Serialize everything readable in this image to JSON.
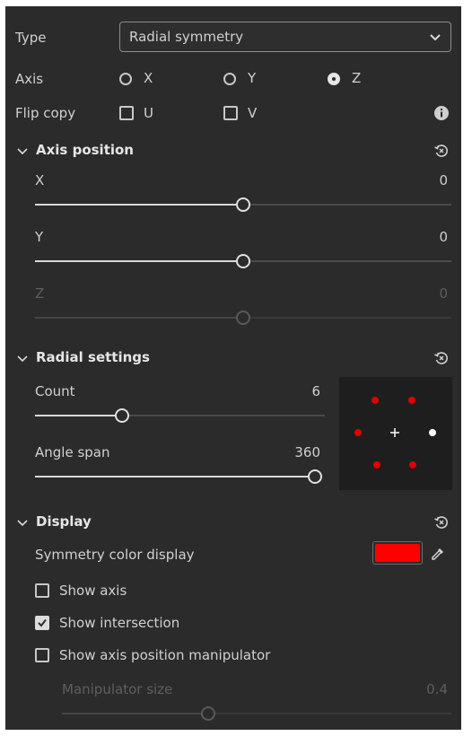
{
  "type_row": {
    "label": "Type",
    "value": "Radial symmetry"
  },
  "axis_row": {
    "label": "Axis",
    "options": [
      "X",
      "Y",
      "Z"
    ],
    "selected": "Z"
  },
  "flip_row": {
    "label": "Flip copy",
    "options": [
      "U",
      "V"
    ],
    "checked": [
      false,
      false
    ]
  },
  "axis_position": {
    "title": "Axis position",
    "sliders": [
      {
        "label": "X",
        "value": "0",
        "fraction": 0.5,
        "enabled": true
      },
      {
        "label": "Y",
        "value": "0",
        "fraction": 0.5,
        "enabled": true
      },
      {
        "label": "Z",
        "value": "0",
        "fraction": 0.5,
        "enabled": false
      }
    ]
  },
  "radial_settings": {
    "title": "Radial settings",
    "count": {
      "label": "Count",
      "value": "6",
      "fraction": 0.3
    },
    "angle_span": {
      "label": "Angle span",
      "value": "360",
      "fraction": 1.0
    }
  },
  "display": {
    "title": "Display",
    "color_label": "Symmetry color display",
    "color": "#ff0000",
    "checkboxes": [
      {
        "label": "Show axis",
        "checked": false
      },
      {
        "label": "Show intersection",
        "checked": true
      },
      {
        "label": "Show axis position manipulator",
        "checked": false
      }
    ],
    "manipulator_size": {
      "label": "Manipulator size",
      "value": "0.4",
      "fraction": 0.375,
      "enabled": false
    }
  },
  "colors": {
    "panel_bg": "#2b2b2b",
    "symmetry_red": "#e00000",
    "preview_bg": "#1e1e1e"
  }
}
